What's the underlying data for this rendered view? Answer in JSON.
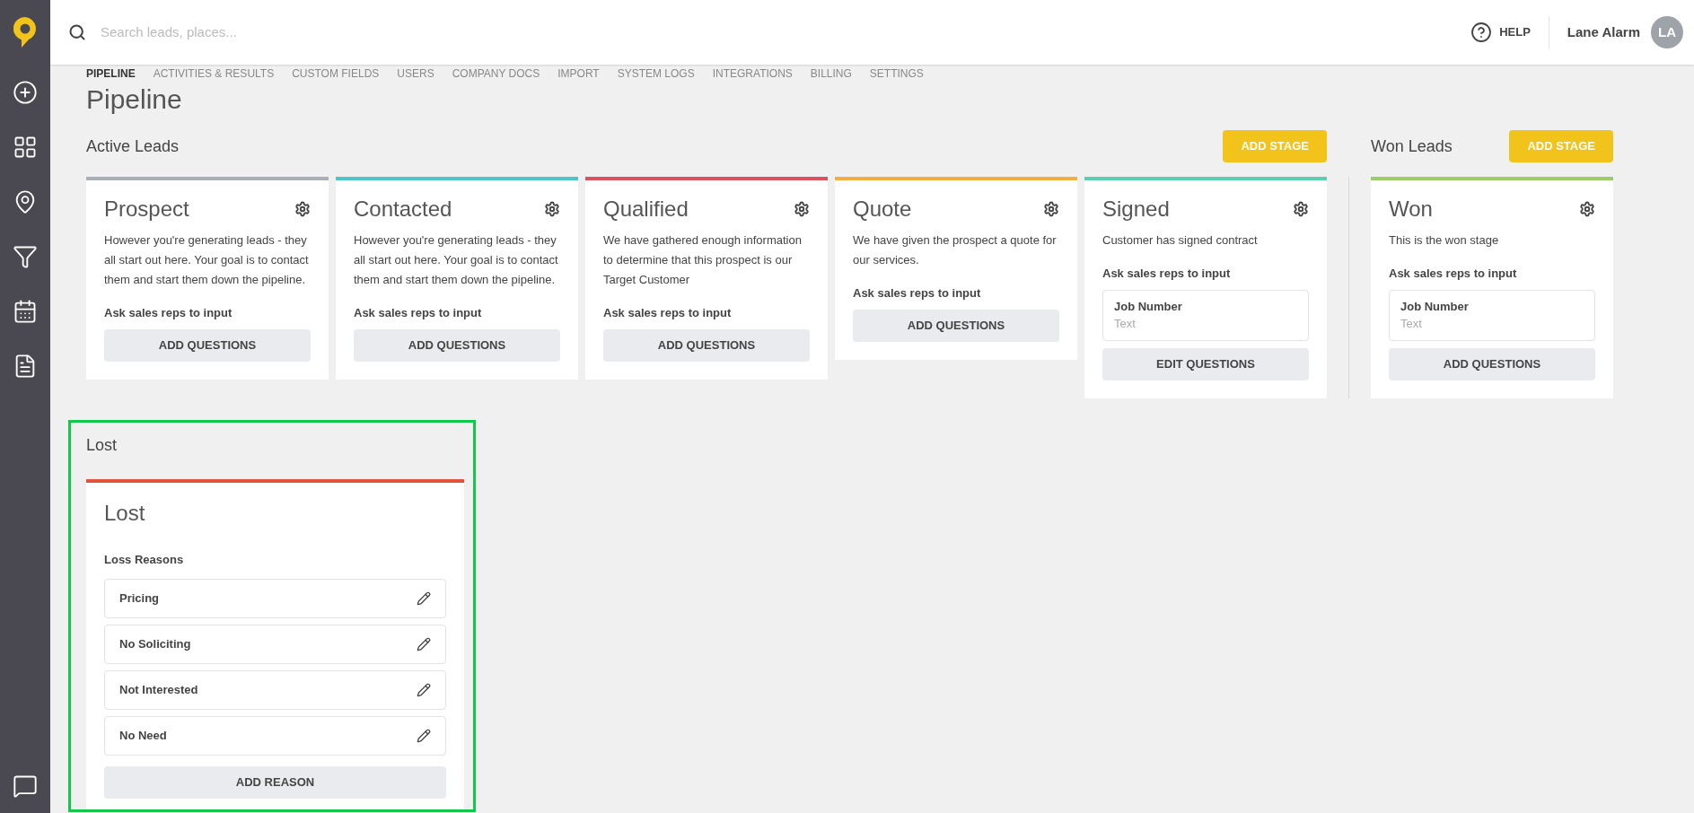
{
  "search": {
    "placeholder": "Search leads, places..."
  },
  "help": "HELP",
  "user": {
    "name": "Lane Alarm",
    "initials": "LA"
  },
  "nav_tabs": [
    {
      "label": "PIPELINE",
      "selected": true
    },
    {
      "label": "ACTIVITIES & RESULTS",
      "selected": false
    },
    {
      "label": "CUSTOM FIELDS",
      "selected": false
    },
    {
      "label": "USERS",
      "selected": false
    },
    {
      "label": "COMPANY DOCS",
      "selected": false
    },
    {
      "label": "IMPORT",
      "selected": false
    },
    {
      "label": "SYSTEM LOGS",
      "selected": false
    },
    {
      "label": "INTEGRATIONS",
      "selected": false
    },
    {
      "label": "BILLING",
      "selected": false
    },
    {
      "label": "SETTINGS",
      "selected": false
    }
  ],
  "page_title": "Pipeline",
  "active_leads": {
    "title": "Active Leads",
    "button": "ADD STAGE",
    "stages": [
      {
        "name": "Prospect",
        "color": "#a9b0b8",
        "description": "However you're generating leads - they all start out here. Your goal is to contact them and start them down the pipeline.",
        "prompt": "Ask sales reps to input",
        "button": "ADD QUESTIONS"
      },
      {
        "name": "Contacted",
        "color": "#4fc4c9",
        "description": "However you're generating leads - they all start out here. Your goal is to contact them and start them down the pipeline.",
        "prompt": "Ask sales reps to input",
        "button": "ADD QUESTIONS"
      },
      {
        "name": "Qualified",
        "color": "#d9535f",
        "description": "We have gathered enough information to determine that this prospect is our Target Customer",
        "prompt": "Ask sales reps to input",
        "button": "ADD QUESTIONS"
      },
      {
        "name": "Quote",
        "color": "#f2ae43",
        "description": "We have given the prospect a quote for our services.",
        "prompt": "Ask sales reps to input",
        "button": "ADD QUESTIONS"
      },
      {
        "name": "Signed",
        "color": "#5ccfae",
        "description": "Customer has signed contract",
        "prompt": "Ask sales reps to input",
        "questions": [
          {
            "label": "Job Number",
            "placeholder": "Text"
          }
        ],
        "button": "EDIT QUESTIONS"
      }
    ]
  },
  "won_leads": {
    "title": "Won Leads",
    "button": "ADD STAGE",
    "stages": [
      {
        "name": "Won",
        "color": "#9ccc65",
        "description": "This is the won stage",
        "prompt": "Ask sales reps to input",
        "questions": [
          {
            "label": "Job Number",
            "placeholder": "Text"
          }
        ],
        "button": "ADD QUESTIONS"
      }
    ]
  },
  "lost": {
    "title": "Lost",
    "card": {
      "name": "Lost",
      "color": "#e0533c",
      "reasons_label": "Loss Reasons",
      "reasons": [
        "Pricing",
        "No Soliciting",
        "Not Interested",
        "No Need"
      ],
      "button": "ADD REASON"
    }
  }
}
